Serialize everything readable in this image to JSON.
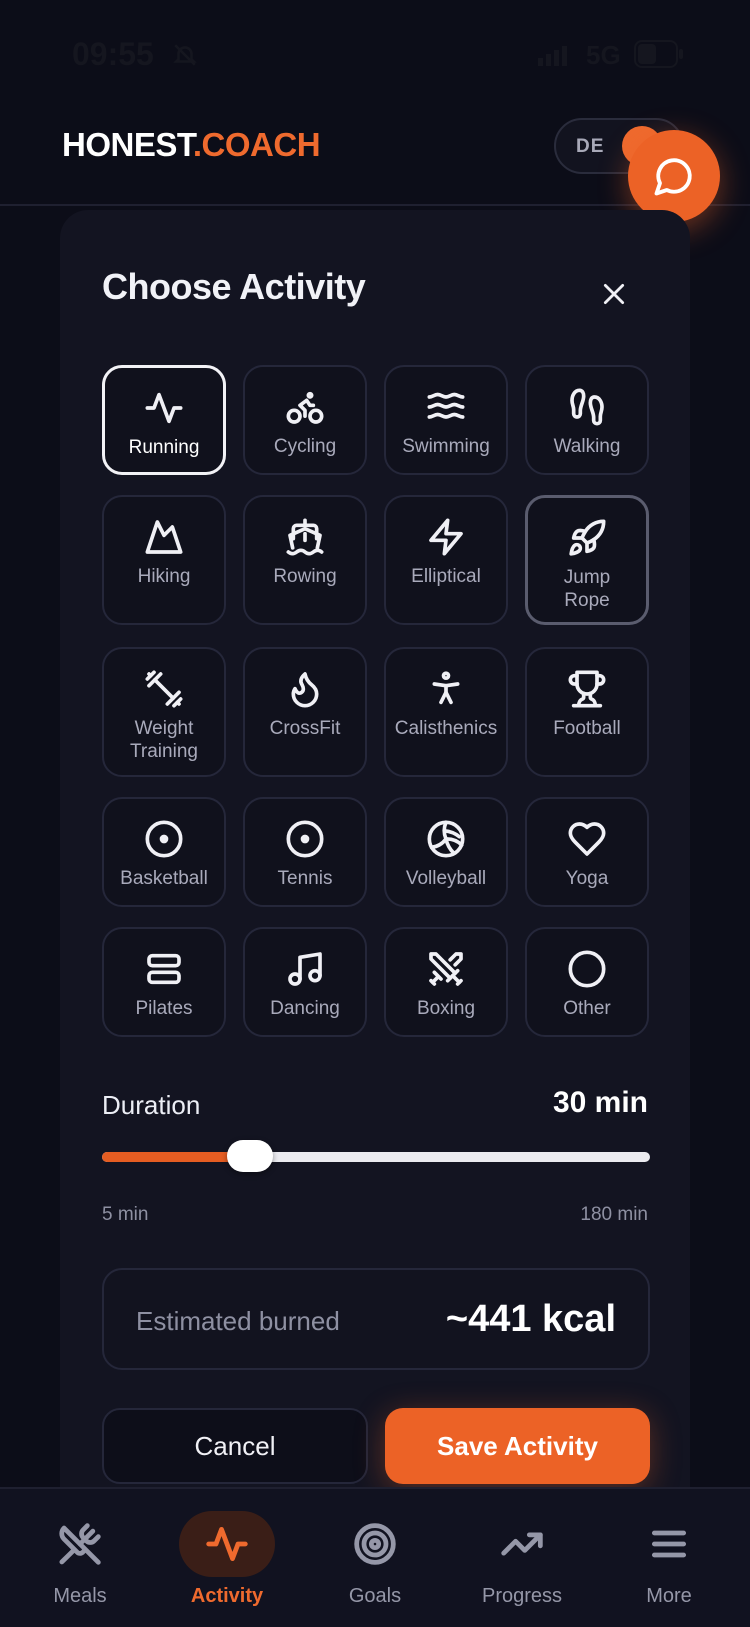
{
  "status_bar": {
    "time": "09:55",
    "network": "5G"
  },
  "header": {
    "brand_part1": "HONEST",
    "brand_part2": ".COACH",
    "language": "DE"
  },
  "sheet": {
    "title": "Choose Activity",
    "activities": [
      {
        "label": "Running",
        "icon": "activity-icon",
        "state": "selected"
      },
      {
        "label": "Cycling",
        "icon": "bike-icon",
        "state": ""
      },
      {
        "label": "Swimming",
        "icon": "waves-icon",
        "state": ""
      },
      {
        "label": "Walking",
        "icon": "footprints-icon",
        "state": ""
      },
      {
        "label": "Hiking",
        "icon": "mountain-icon",
        "state": ""
      },
      {
        "label": "Rowing",
        "icon": "ship-icon",
        "state": ""
      },
      {
        "label": "Elliptical",
        "icon": "zap-icon",
        "state": ""
      },
      {
        "label": "Jump Rope",
        "icon": "rocket-icon",
        "state": "highlight"
      },
      {
        "label": "Weight Training",
        "icon": "dumbbell-icon",
        "state": ""
      },
      {
        "label": "CrossFit",
        "icon": "flame-icon",
        "state": ""
      },
      {
        "label": "Calisthenics",
        "icon": "person-icon",
        "state": ""
      },
      {
        "label": "Football",
        "icon": "trophy-icon",
        "state": ""
      },
      {
        "label": "Basketball",
        "icon": "circle-dot-icon",
        "state": ""
      },
      {
        "label": "Tennis",
        "icon": "circle-dot-icon",
        "state": ""
      },
      {
        "label": "Volleyball",
        "icon": "volleyball-icon",
        "state": ""
      },
      {
        "label": "Yoga",
        "icon": "heart-icon",
        "state": ""
      },
      {
        "label": "Pilates",
        "icon": "layers-icon",
        "state": ""
      },
      {
        "label": "Dancing",
        "icon": "music-icon",
        "state": ""
      },
      {
        "label": "Boxing",
        "icon": "swords-icon",
        "state": ""
      },
      {
        "label": "Other",
        "icon": "circle-icon",
        "state": ""
      }
    ],
    "duration": {
      "label": "Duration",
      "value_text": "30 min",
      "value": 30,
      "min": 5,
      "max": 180,
      "min_label": "5 min",
      "max_label": "180 min"
    },
    "estimate": {
      "label": "Estimated burned",
      "value": "~441 kcal"
    },
    "cancel_label": "Cancel",
    "save_label": "Save Activity"
  },
  "tabbar": {
    "tabs": [
      {
        "label": "Meals",
        "icon": "utensils-icon",
        "active": false
      },
      {
        "label": "Activity",
        "icon": "activity-icon",
        "active": true
      },
      {
        "label": "Goals",
        "icon": "target-icon",
        "active": false
      },
      {
        "label": "Progress",
        "icon": "trending-up-icon",
        "active": false
      },
      {
        "label": "More",
        "icon": "menu-icon",
        "active": false
      }
    ]
  },
  "colors": {
    "accent": "#ec6226",
    "background": "#0c0d18",
    "sheet": "#131421"
  }
}
